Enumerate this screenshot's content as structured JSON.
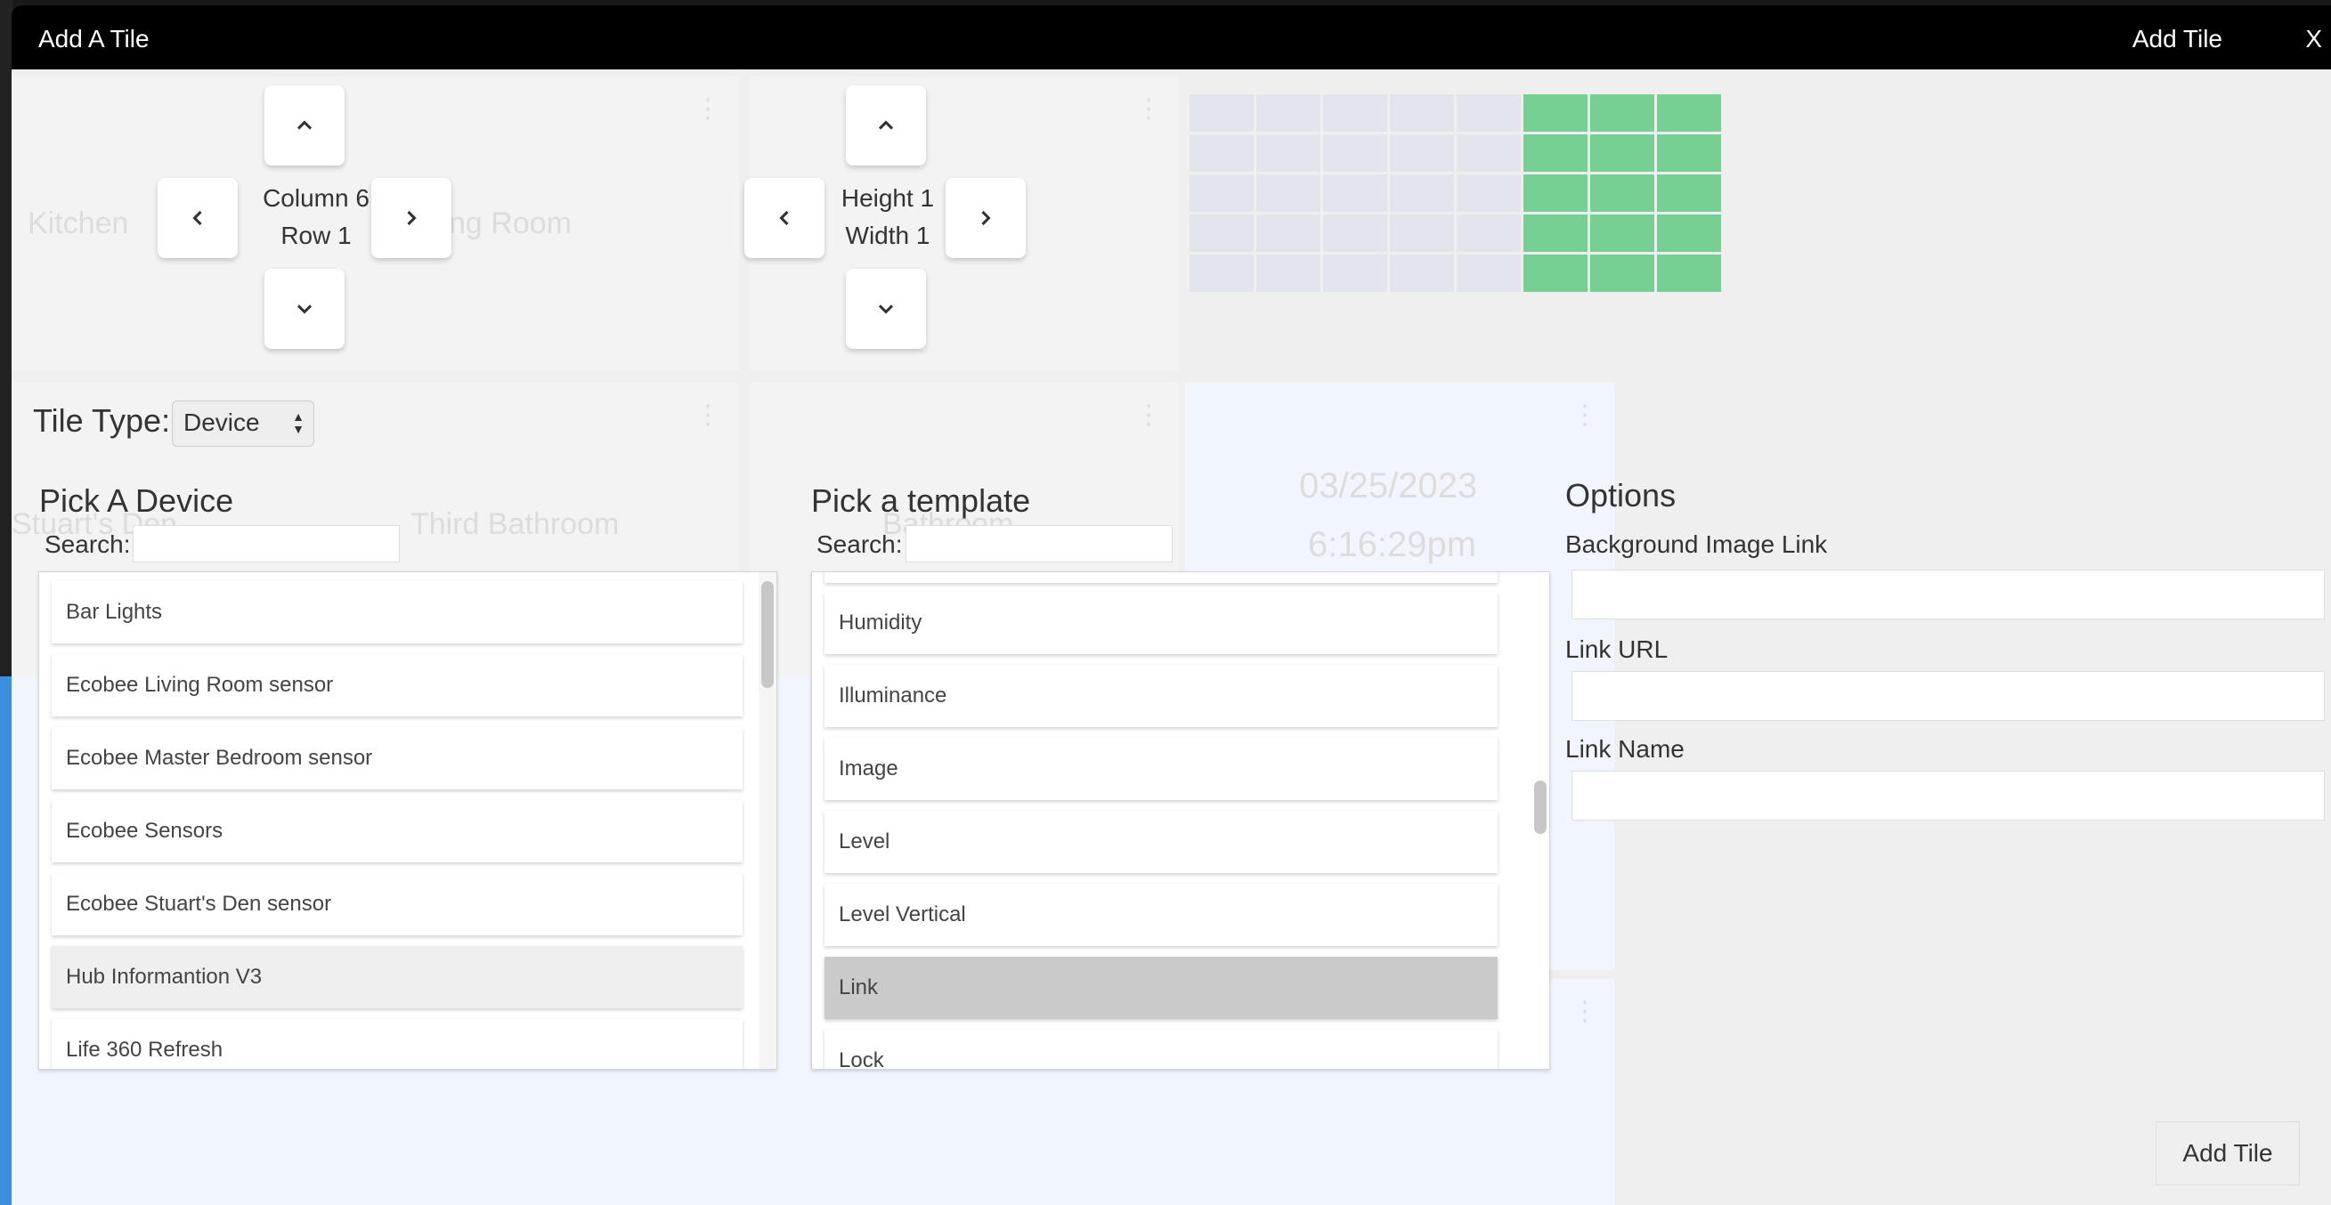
{
  "dialog": {
    "title": "Add A Tile",
    "add_tile_label": "Add Tile",
    "close_label": "X"
  },
  "background_tiles": {
    "kitchen": "Kitchen",
    "living_room": "Living Room",
    "stuart_den": "Stuart's Den",
    "third_bathroom": "Third Bathroom",
    "bathroom": "Bathroom",
    "date": "03/25/2023",
    "time": "6:16:29pm"
  },
  "position": {
    "column_label": "Column 6",
    "row_label": "Row 1"
  },
  "size": {
    "height_label": "Height 1",
    "width_label": "Width 1"
  },
  "grid_preview": {
    "columns": 8,
    "rows": 5,
    "highlighted_columns": [
      6,
      7,
      8
    ]
  },
  "tile_type": {
    "label": "Tile Type:",
    "value": "Device"
  },
  "devices": {
    "title": "Pick A Device",
    "search_label": "Search:",
    "search_value": "",
    "items": [
      "Bar Lights",
      "Ecobee Living Room sensor",
      "Ecobee Master Bedroom sensor",
      "Ecobee Sensors",
      "Ecobee Stuart's Den sensor",
      "Hub Informantion V3",
      "Life 360 Refresh"
    ],
    "hovered": "Hub Informantion V3"
  },
  "templates": {
    "title": "Pick a template",
    "search_label": "Search:",
    "search_value": "",
    "items": [
      "Humidity",
      "Illuminance",
      "Image",
      "Level",
      "Level Vertical",
      "Link",
      "Lock"
    ],
    "selected": "Link"
  },
  "options": {
    "title": "Options",
    "fields": [
      {
        "label": "Background Image Link",
        "value": ""
      },
      {
        "label": "Link URL",
        "value": ""
      },
      {
        "label": "Link Name",
        "value": ""
      }
    ]
  },
  "footer": {
    "add_tile_label": "Add Tile"
  },
  "colors": {
    "titlebar": "#000000",
    "grid_highlight": "#77d093",
    "grid_cell": "#e2e6ec",
    "selected_item": "#cacaca"
  }
}
